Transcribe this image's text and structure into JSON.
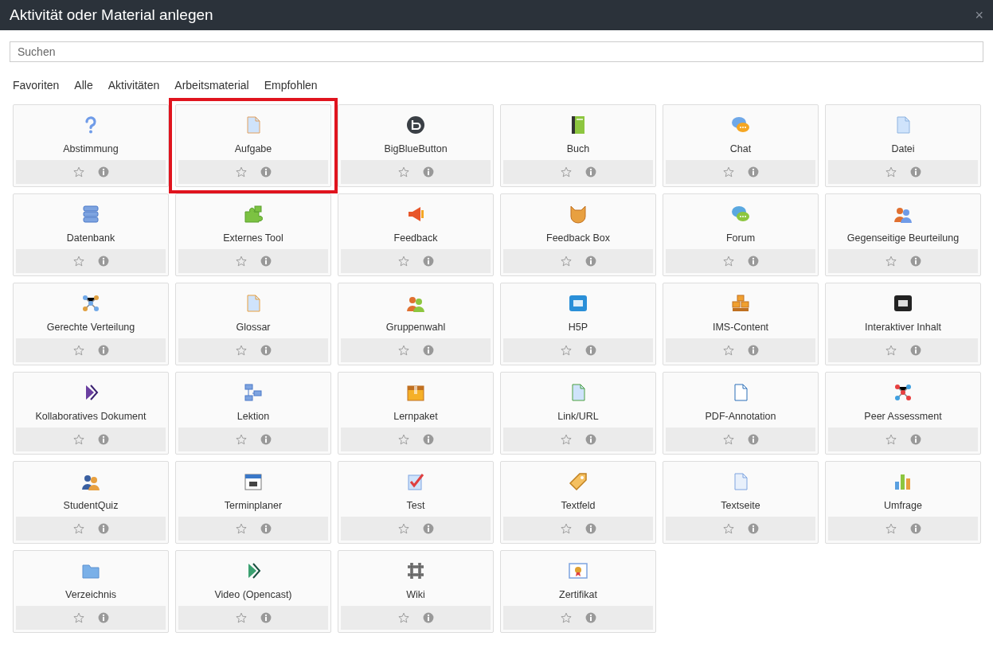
{
  "window": {
    "title": "Aktivität oder Material anlegen",
    "close": "×"
  },
  "search": {
    "placeholder": "Suchen"
  },
  "tabs": [
    {
      "label": "Favoriten"
    },
    {
      "label": "Alle"
    },
    {
      "label": "Aktivitäten"
    },
    {
      "label": "Arbeitsmaterial"
    },
    {
      "label": "Empfohlen"
    }
  ],
  "modules": [
    {
      "label": "Abstimmung",
      "highlighted": false
    },
    {
      "label": "Aufgabe",
      "highlighted": true
    },
    {
      "label": "BigBlueButton",
      "highlighted": false
    },
    {
      "label": "Buch",
      "highlighted": false
    },
    {
      "label": "Chat",
      "highlighted": false
    },
    {
      "label": "Datei",
      "highlighted": false
    },
    {
      "label": "Datenbank",
      "highlighted": false
    },
    {
      "label": "Externes Tool",
      "highlighted": false
    },
    {
      "label": "Feedback",
      "highlighted": false
    },
    {
      "label": "Feedback Box",
      "highlighted": false
    },
    {
      "label": "Forum",
      "highlighted": false
    },
    {
      "label": "Gegenseitige Beurteilung",
      "highlighted": false
    },
    {
      "label": "Gerechte Verteilung",
      "highlighted": false
    },
    {
      "label": "Glossar",
      "highlighted": false
    },
    {
      "label": "Gruppenwahl",
      "highlighted": false
    },
    {
      "label": "H5P",
      "highlighted": false
    },
    {
      "label": "IMS-Content",
      "highlighted": false
    },
    {
      "label": "Interaktiver Inhalt",
      "highlighted": false
    },
    {
      "label": "Kollaboratives Dokument",
      "highlighted": false
    },
    {
      "label": "Lektion",
      "highlighted": false
    },
    {
      "label": "Lernpaket",
      "highlighted": false
    },
    {
      "label": "Link/URL",
      "highlighted": false
    },
    {
      "label": "PDF-Annotation",
      "highlighted": false
    },
    {
      "label": "Peer Assessment",
      "highlighted": false
    },
    {
      "label": "StudentQuiz",
      "highlighted": false
    },
    {
      "label": "Terminplaner",
      "highlighted": false
    },
    {
      "label": "Test",
      "highlighted": false
    },
    {
      "label": "Textfeld",
      "highlighted": false
    },
    {
      "label": "Textseite",
      "highlighted": false
    },
    {
      "label": "Umfrage",
      "highlighted": false
    },
    {
      "label": "Verzeichnis",
      "highlighted": false
    },
    {
      "label": "Video (Opencast)",
      "highlighted": false
    },
    {
      "label": "Wiki",
      "highlighted": false
    },
    {
      "label": "Zertifikat",
      "highlighted": false
    }
  ]
}
